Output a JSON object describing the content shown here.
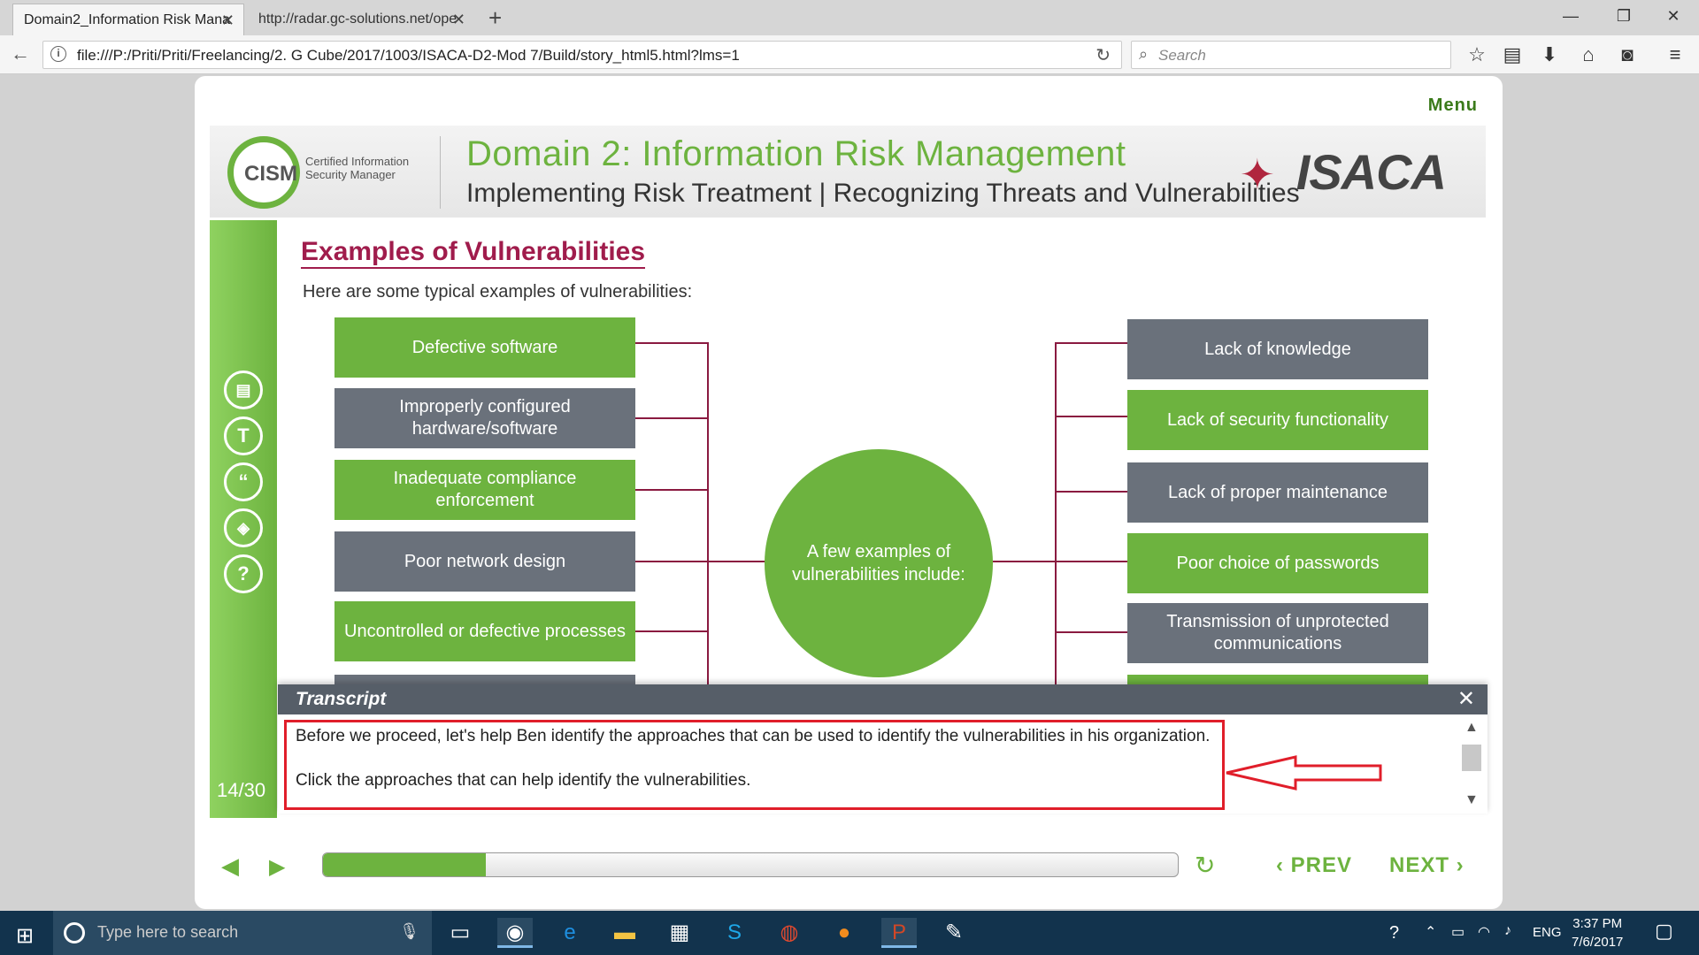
{
  "browser": {
    "tabs": [
      {
        "label": "Domain2_Information Risk Mana",
        "active": true
      },
      {
        "label": "http://radar.gc-solutions.net/ope",
        "active": false
      }
    ],
    "url": "file:///P:/Priti/Priti/Freelancing/2. G Cube/2017/1003/ISACA-D2-Mod 7/Build/story_html5.html?lms=1",
    "search_placeholder": "Search"
  },
  "course": {
    "menu_label": "Menu",
    "logo_text": "CISM",
    "logo_sub": "Certified Information Security Manager",
    "header_title": "Domain 2: Information Risk Management",
    "header_subtitle": "Implementing Risk Treatment | Recognizing Threats and Vulnerabilities",
    "brand": "ISACA",
    "page_count": "14/30",
    "slide_title": "Examples of Vulnerabilities",
    "intro": "Here are some typical examples of vulnerabilities:",
    "center_text": "A few examples of vulnerabilities include:",
    "left_items": [
      {
        "label": "Defective software",
        "color": "#6db33f"
      },
      {
        "label": "Improperly configured hardware/software",
        "color": "#6a717b"
      },
      {
        "label": "Inadequate compliance enforcement",
        "color": "#6db33f"
      },
      {
        "label": "Poor network design",
        "color": "#6a717b"
      },
      {
        "label": "Uncontrolled or defective processes",
        "color": "#6db33f"
      }
    ],
    "right_items": [
      {
        "label": "Lack of knowledge",
        "color": "#6a717b"
      },
      {
        "label": "Lack of security functionality",
        "color": "#6db33f"
      },
      {
        "label": "Lack of proper maintenance",
        "color": "#6a717b"
      },
      {
        "label": "Poor choice of passwords",
        "color": "#6db33f"
      },
      {
        "label": "Transmission of unprotected communications",
        "color": "#6a717b"
      }
    ],
    "transcript": {
      "title": "Transcript",
      "line1": "Before we proceed, let's help Ben identify the approaches that can be used to identify the vulnerabilities in his organization.",
      "line2": "Click the approaches that can help identify the vulnerabilities."
    },
    "controls": {
      "prev_label": "PREV",
      "next_label": "NEXT",
      "progress": 0.19
    },
    "accent_color": "#6db33f",
    "title_color": "#a01c4c"
  },
  "taskbar": {
    "search_placeholder": "Type here to search",
    "language": "ENG",
    "time": "3:37 PM",
    "date": "7/6/2017"
  }
}
